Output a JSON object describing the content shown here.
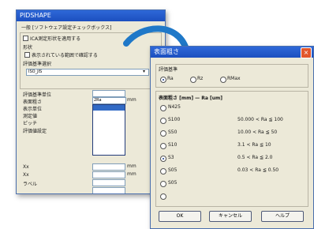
{
  "back_window": {
    "title": "PIDSHAPE",
    "tab": "一般 [ソフトウェア設定チェックボックス]",
    "checkbox_label": "ICA測定形状を適用する",
    "section_label": "形状",
    "checkbox2_label": "表示されている範囲で確認する",
    "field_label_1": "評価基準選択",
    "field_value_1": "ISO_JIS",
    "rows": [
      {
        "label": "評価基準単位",
        "value": "",
        "unit": ""
      },
      {
        "label": "表面粗さ",
        "value": "2Ra",
        "unit": "mm"
      },
      {
        "label": "表示単位",
        "value": "",
        "unit": ""
      },
      {
        "label": "測定値",
        "value": "",
        "unit": ""
      },
      {
        "label": "ピッチ",
        "value": "",
        "unit": ""
      },
      {
        "label": "評価値設定",
        "value": "",
        "unit": ""
      }
    ],
    "dropdown_options": [
      "",
      "",
      "",
      "",
      "",
      "",
      "",
      "",
      ""
    ],
    "bottom_rows": [
      {
        "label": "Xx",
        "value": "",
        "unit": "mm"
      },
      {
        "label": "Xx",
        "value": "",
        "unit": "mm"
      },
      {
        "label": "ラベル",
        "value": "",
        "unit": ""
      },
      {
        "label": "",
        "value": "",
        "unit": ""
      }
    ]
  },
  "front_window": {
    "title": "表面粗さ",
    "close_icon": "×",
    "mode_group_label": "評価基準",
    "mode_options": [
      "Ra",
      "Rz",
      "RMax"
    ],
    "mode_selected": 0,
    "list_title": "表面粗さ [mm] — Ra [um]",
    "rows": [
      {
        "code": "N425",
        "range": "",
        "selected": false
      },
      {
        "code": "S100",
        "range": "50.000 < Ra ≦ 100",
        "selected": false
      },
      {
        "code": "S50",
        "range": "10.00 < Ra ≦ 50",
        "selected": false
      },
      {
        "code": "S10",
        "range": "3.1 < Ra ≦ 10",
        "selected": false
      },
      {
        "code": "S3",
        "range": "0.5 < Ra ≦ 2.0",
        "selected": true
      },
      {
        "code": "S05",
        "range": "0.03 < Ra ≦ 0.50",
        "selected": false
      },
      {
        "code": "S05",
        "range": "",
        "selected": false
      },
      {
        "code": "",
        "range": "",
        "selected": false
      }
    ],
    "buttons": {
      "ok": "OK",
      "cancel": "キャンセル",
      "help": "ヘルプ"
    }
  },
  "arrow_color": "#1f78c8"
}
